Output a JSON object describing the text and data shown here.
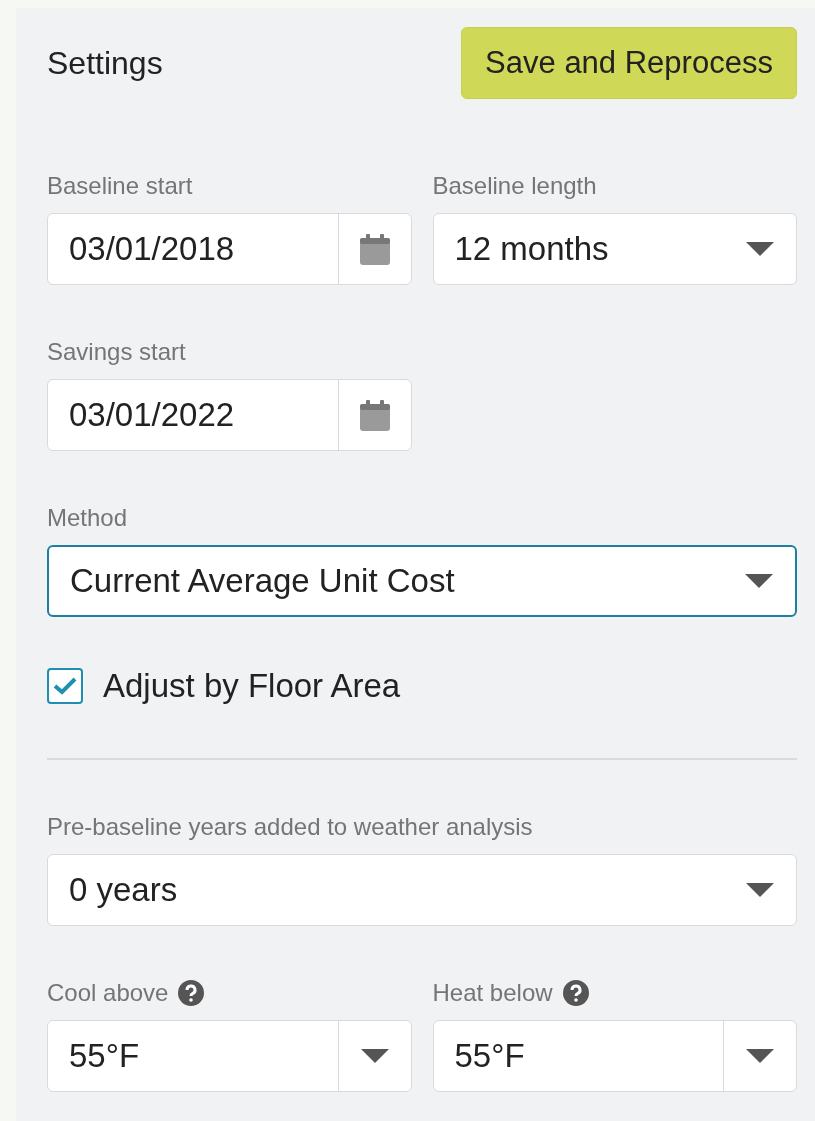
{
  "header": {
    "title": "Settings",
    "save_button": "Save and Reprocess"
  },
  "rows": [
    {
      "kind": "fields",
      "fields": [
        {
          "label": "Baseline start",
          "kind": "date",
          "value": "03/01/2018",
          "focused": false,
          "help": false
        },
        {
          "label": "Baseline length",
          "kind": "select",
          "value": "12 months",
          "focused": false,
          "help": false
        }
      ]
    },
    {
      "kind": "fields",
      "fields": [
        {
          "label": "Savings start",
          "kind": "date",
          "value": "03/01/2022",
          "focused": false,
          "help": false
        }
      ]
    },
    {
      "kind": "fields",
      "fields": [
        {
          "label": "Method",
          "kind": "select",
          "value": "Current Average Unit Cost",
          "focused": true,
          "help": false,
          "wide": true
        }
      ]
    },
    {
      "kind": "checkbox",
      "label": "Adjust by Floor Area",
      "checked": true
    },
    {
      "kind": "divider"
    },
    {
      "kind": "fields",
      "fields": [
        {
          "label": "Pre-baseline years added to weather analysis",
          "kind": "select",
          "value": "0 years",
          "focused": false,
          "help": false,
          "wide": true
        }
      ]
    },
    {
      "kind": "fields",
      "fields": [
        {
          "label": "Cool above",
          "kind": "split_select",
          "value": "55°F",
          "focused": false,
          "help": true
        },
        {
          "label": "Heat below",
          "kind": "split_select",
          "value": "55°F",
          "focused": false,
          "help": true
        }
      ]
    }
  ]
}
